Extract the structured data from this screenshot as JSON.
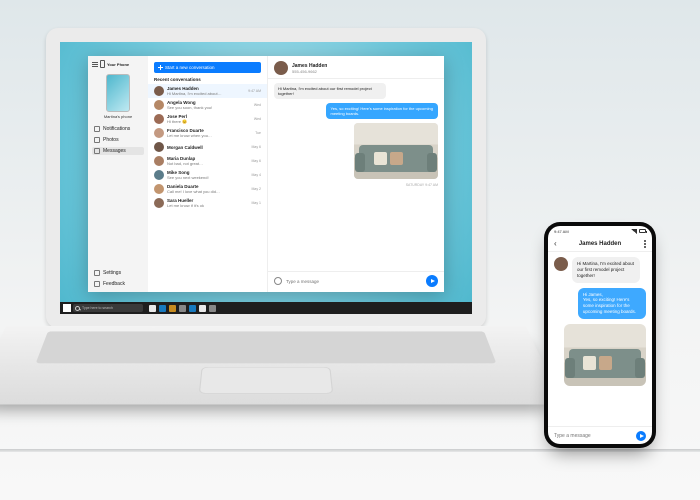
{
  "app": {
    "title": "Your Phone"
  },
  "sidebar": {
    "device_name": "Martina's phone",
    "nav": [
      {
        "label": "Notifications"
      },
      {
        "label": "Photos"
      },
      {
        "label": "Messages"
      }
    ],
    "footer": [
      {
        "label": "Settings"
      },
      {
        "label": "Feedback"
      }
    ]
  },
  "conversations": {
    "new_button": "Start a new conversation",
    "section": "Recent conversations",
    "items": [
      {
        "name": "James Hadden",
        "preview": "Hi Martina, I'm excited about…",
        "date": "9:47 AM",
        "avatar": "#7a5c4b"
      },
      {
        "name": "Angela Wong",
        "preview": "See you soon, thank you!",
        "date": "Wed",
        "avatar": "#b58866"
      },
      {
        "name": "Jose Perl",
        "preview": "Hi there 😊",
        "date": "Wed",
        "avatar": "#9c6b55"
      },
      {
        "name": "Francisco Duarte",
        "preview": "Let me know when you…",
        "date": "Tue",
        "avatar": "#c49a82"
      },
      {
        "name": "Morgan Caldwell",
        "preview": "",
        "date": "May 6",
        "avatar": "#6f5648"
      },
      {
        "name": "Maria Dunlap",
        "preview": "Not bad, not great…",
        "date": "May 6",
        "avatar": "#a97e63"
      },
      {
        "name": "Mike Song",
        "preview": "See you next weekend!",
        "date": "May 4",
        "avatar": "#5b7c8a"
      },
      {
        "name": "Daniela Duarte",
        "preview": "Call me! I love what you did…",
        "date": "May 2",
        "avatar": "#c2956f"
      },
      {
        "name": "Sara Hueller",
        "preview": "Let me know if it's ok",
        "date": "May 1",
        "avatar": "#8b6a57"
      }
    ]
  },
  "chat": {
    "contact_name": "James Hadden",
    "contact_sub": "555-456-9662",
    "avatar": "#7a5c4b",
    "messages": {
      "m1": "Hi Martina, I'm excited about our first remodel project together!",
      "m2": "Yes, so exciting! Here's some inspiration for the upcoming meeting boards."
    },
    "timestamp": "SATURDAY 9:47 AM",
    "input_placeholder": "Type a message"
  },
  "taskbar": {
    "search_placeholder": "Type here to search"
  },
  "phone": {
    "time": "9:47 AM",
    "contact_name": "James Hadden",
    "avatar": "#7a5c4b",
    "m1": "Hi Martina, I'm excited about our first remodel project together!",
    "m2": "Hi James,\nYes, so exciting! Here's some inspiration for the upcoming meeting boards.",
    "input_placeholder": "Type a message"
  }
}
